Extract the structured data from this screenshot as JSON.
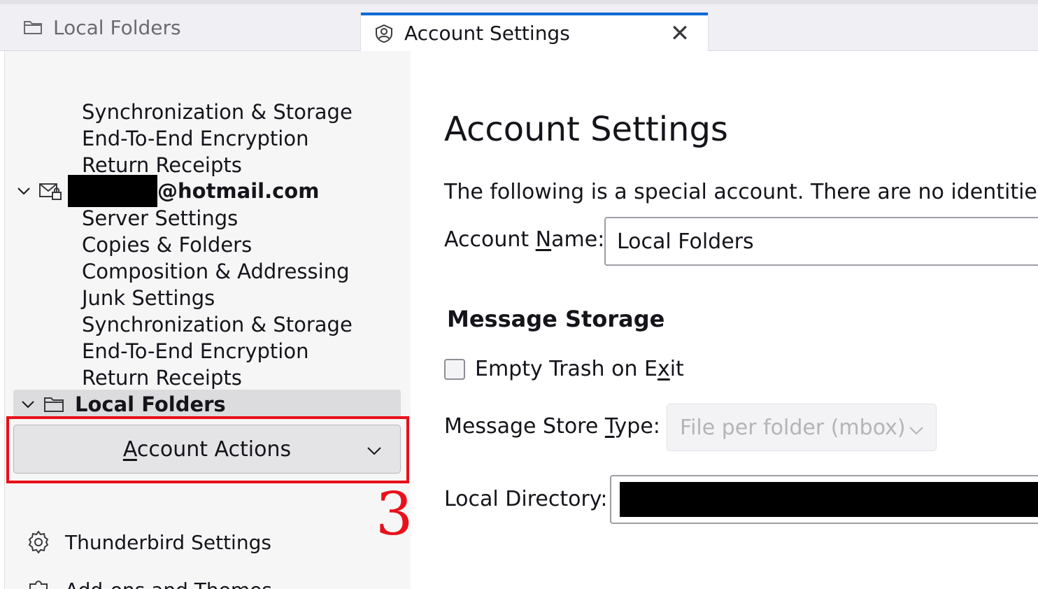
{
  "tabs": [
    {
      "label": "Local Folders",
      "icon": "folder-icon",
      "active": false
    },
    {
      "label": "Account Settings",
      "icon": "account-settings-icon",
      "active": true,
      "close": "✕"
    }
  ],
  "sidebar": {
    "tree_items_top": [
      "Synchronization & Storage",
      "End-To-End Encryption",
      "Return Receipts"
    ],
    "account": {
      "email_suffix": "@hotmail.com",
      "icon": "mail-account-icon"
    },
    "account_items": [
      "Server Settings",
      "Copies & Folders",
      "Composition & Addressing",
      "Junk Settings",
      "Synchronization & Storage",
      "End-To-End Encryption",
      "Return Receipts"
    ],
    "local_folders": {
      "label": "Local Folders",
      "icon": "folder-icon"
    },
    "account_actions": {
      "label_prefix": "A",
      "label_rest": "ccount Actions"
    },
    "annotation_number": "3",
    "footer": [
      {
        "label": "Thunderbird Settings",
        "icon": "gear-icon"
      },
      {
        "label": "Add-ons and Themes",
        "icon": "puzzle-icon"
      }
    ]
  },
  "main": {
    "title": "Account Settings",
    "description": "The following is a special account. There are no identities associated with it.",
    "account_name": {
      "label_a": "Account ",
      "label_u": "N",
      "label_b": "ame:",
      "value": "Local Folders"
    },
    "message_storage": {
      "heading": "Message Storage",
      "empty_trash": {
        "label_a": "Empty Trash on E",
        "label_u": "x",
        "label_b": "it",
        "checked": false
      },
      "store_type": {
        "label_a": "Message Store ",
        "label_u": "T",
        "label_b": "ype:",
        "value": "File per folder (mbox)"
      },
      "local_directory": {
        "label": "Local Directory:"
      }
    }
  }
}
